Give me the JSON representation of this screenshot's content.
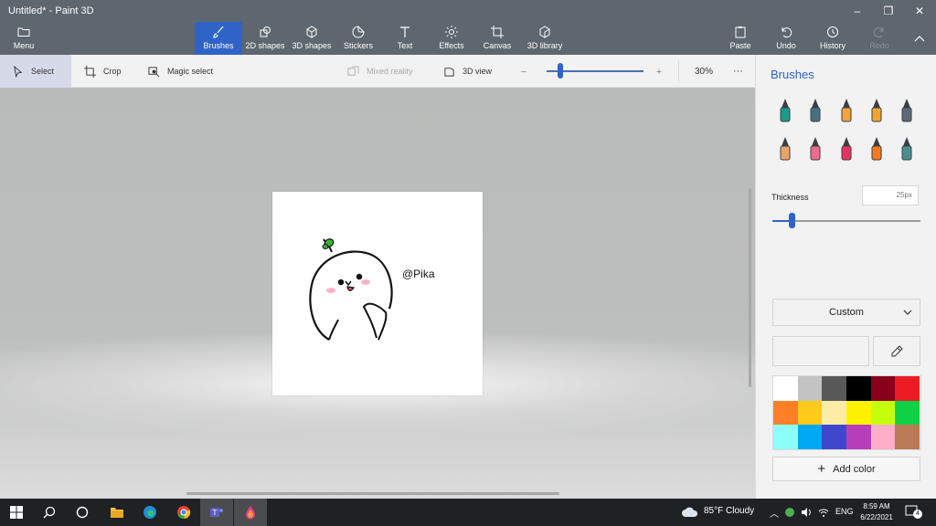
{
  "window": {
    "title": "Untitled* - Paint 3D",
    "controls": {
      "minimize": "–",
      "maximize": "❐",
      "close": "✕"
    }
  },
  "ribbon": {
    "menu": {
      "label": "Menu",
      "icon": "folder-icon"
    },
    "tools": [
      {
        "label": "Brushes",
        "icon": "brush-icon",
        "active": true
      },
      {
        "label": "2D shapes",
        "icon": "2d-shapes-icon"
      },
      {
        "label": "3D shapes",
        "icon": "cube-icon"
      },
      {
        "label": "Stickers",
        "icon": "sticker-icon"
      },
      {
        "label": "Text",
        "icon": "text-icon"
      },
      {
        "label": "Effects",
        "icon": "sun-icon"
      },
      {
        "label": "Canvas",
        "icon": "canvas-icon"
      },
      {
        "label": "3D library",
        "icon": "library-icon"
      }
    ],
    "right": [
      {
        "label": "Paste",
        "icon": "clipboard-icon"
      },
      {
        "label": "Undo",
        "icon": "undo-icon"
      },
      {
        "label": "History",
        "icon": "history-icon"
      },
      {
        "label": "Redo",
        "icon": "redo-icon",
        "disabled": true
      }
    ],
    "active_color": "#2f63c7"
  },
  "toolbar": {
    "select": "Select",
    "crop": "Crop",
    "magic_select": "Magic select",
    "mixed_reality": "Mixed reality",
    "view_3d": "3D view",
    "zoom_value": 0.3,
    "zoom_label": "30%",
    "more": "···"
  },
  "canvas": {
    "caption": "@Pika"
  },
  "panel": {
    "title": "Brushes",
    "brushes": [
      {
        "name": "marker",
        "color": "#1a9b8a"
      },
      {
        "name": "calligraphy-pen",
        "color": "#4a6f82"
      },
      {
        "name": "oil-brush",
        "color": "#f2a53a"
      },
      {
        "name": "watercolor",
        "color": "#f0a531"
      },
      {
        "name": "pixel-pen",
        "color": "#5c6b79"
      },
      {
        "name": "pencil",
        "color": "#e9a46a"
      },
      {
        "name": "eraser",
        "color": "#ee6b8b"
      },
      {
        "name": "crayon",
        "color": "#e8335f"
      },
      {
        "name": "spray-can",
        "color": "#f57a20"
      },
      {
        "name": "fill",
        "color": "#4a8f8f"
      }
    ],
    "thickness_label": "Thickness",
    "thickness_value": "25px",
    "thickness_level": 0.14,
    "color_mode": "Custom",
    "palette": [
      "#ffffff",
      "#c3c3c3",
      "#585858",
      "#000000",
      "#88001b",
      "#ec1c24",
      "#ff7f27",
      "#ffca18",
      "#fdeca6",
      "#fff200",
      "#c4ff0e",
      "#0ed145",
      "#8cfffb",
      "#00a8f3",
      "#3f48cc",
      "#b83dba",
      "#ffaec8",
      "#b97a56"
    ],
    "add_color": "Add color"
  },
  "taskbar": {
    "weather": "85°F  Cloudy",
    "language": "ENG",
    "time": "8:59 AM",
    "date": "6/22/2021",
    "notifications": "4"
  }
}
